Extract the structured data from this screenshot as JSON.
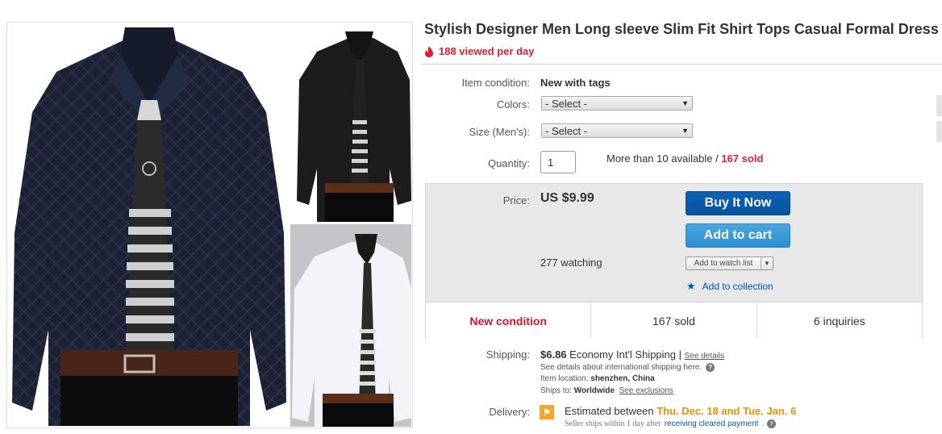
{
  "listing": {
    "title": "Stylish Designer Men Long sleeve Slim Fit Shirt Tops Casual Formal Dress",
    "views": "188 viewed per day"
  },
  "details": {
    "condition_label": "Item condition:",
    "condition_value": "New with tags",
    "colors_label": "Colors:",
    "colors_selected": "- Select -",
    "size_label": "Size (Men's):",
    "size_selected": "- Select -",
    "quantity_label": "Quantity:",
    "quantity_value": "1",
    "available_text": "More than 10 available / ",
    "sold_text": "167 sold"
  },
  "buybox": {
    "price_label": "Price:",
    "price_value": "US $9.99",
    "buy_now_label": "Buy It Now",
    "add_to_cart_label": "Add to cart",
    "watching_text": "277 watching",
    "watch_list_label": "Add to watch list",
    "collection_label": "Add to collection",
    "stats": {
      "condition": "New condition",
      "sold": "167 sold",
      "inquiries": "6 inquiries"
    }
  },
  "shipping": {
    "label": "Shipping:",
    "cost": "$6.86",
    "method": "Economy Int'l Shipping",
    "divider": "|",
    "details_link": "See details",
    "intl_text": "See details about international shipping here.",
    "location_label": "Item location:",
    "location_value": "shenzhen, China",
    "ships_to_label": "Ships to:",
    "ships_to_value": "Worldwide",
    "exclusions_link": "See exclusions"
  },
  "delivery": {
    "label": "Delivery:",
    "estimate_prefix": "Estimated between ",
    "estimate_dates": "Thu. Dec. 18 and Tue. Jan. 6",
    "note_prefix": "Seller ships within 1 day after",
    "note_link": "receiving cleared payment",
    "note_suffix": "."
  },
  "colors": {
    "accent_red": "#dd1e31",
    "buy_now_blue": "#0654a0",
    "cart_blue": "#3b9ad9",
    "link_blue": "#0654ba",
    "delivery_orange": "#f18e00"
  },
  "icons": {
    "views": "flame-icon",
    "help": "question-circle-icon",
    "collection": "star-icon",
    "delivery": "flag-icon"
  }
}
